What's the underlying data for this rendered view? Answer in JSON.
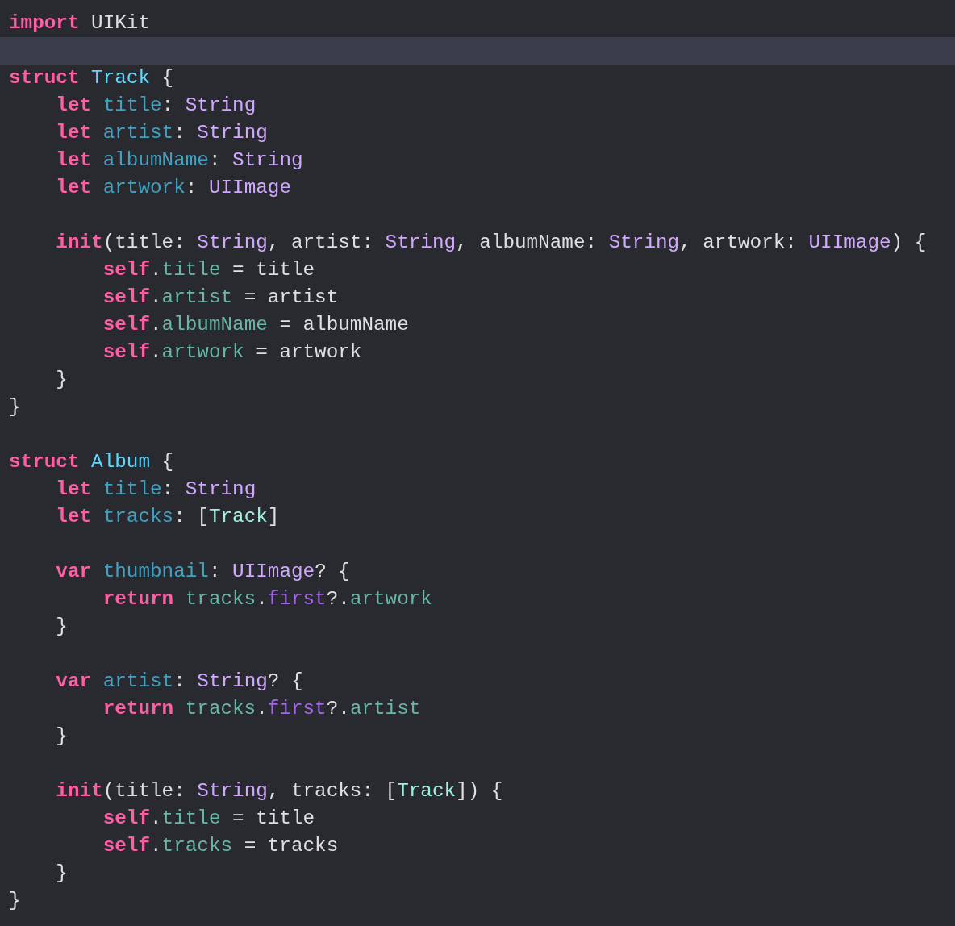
{
  "editor": {
    "lines": [
      {
        "current": false,
        "tokens": [
          {
            "kind": "keyword",
            "text": "import"
          },
          {
            "kind": "plain",
            "text": " UIKit"
          }
        ]
      },
      {
        "current": true
      },
      {
        "current": false,
        "tokens": [
          {
            "kind": "keyword",
            "text": "struct "
          },
          {
            "kind": "decl",
            "text": "Track"
          },
          {
            "kind": "plain",
            "text": " {"
          }
        ]
      },
      {
        "current": false,
        "tokens": [
          {
            "kind": "keyword",
            "text": "    let "
          },
          {
            "kind": "prop",
            "text": "title"
          },
          {
            "kind": "plain",
            "text": ": "
          },
          {
            "kind": "type",
            "text": "String"
          }
        ]
      },
      {
        "current": false,
        "tokens": [
          {
            "kind": "keyword",
            "text": "    let "
          },
          {
            "kind": "prop",
            "text": "artist"
          },
          {
            "kind": "plain",
            "text": ": "
          },
          {
            "kind": "type",
            "text": "String"
          }
        ]
      },
      {
        "current": false,
        "tokens": [
          {
            "kind": "keyword",
            "text": "    let "
          },
          {
            "kind": "prop",
            "text": "albumName"
          },
          {
            "kind": "plain",
            "text": ": "
          },
          {
            "kind": "type",
            "text": "String"
          }
        ]
      },
      {
        "current": false,
        "tokens": [
          {
            "kind": "keyword",
            "text": "    let "
          },
          {
            "kind": "prop",
            "text": "artwork"
          },
          {
            "kind": "plain",
            "text": ": "
          },
          {
            "kind": "type",
            "text": "UIImage"
          }
        ]
      },
      {
        "current": false
      },
      {
        "current": false,
        "tokens": [
          {
            "kind": "keyword",
            "text": "    init"
          },
          {
            "kind": "plain",
            "text": "(title: "
          },
          {
            "kind": "type",
            "text": "String"
          },
          {
            "kind": "plain",
            "text": ", artist: "
          },
          {
            "kind": "type",
            "text": "String"
          },
          {
            "kind": "plain",
            "text": ", albumName: "
          },
          {
            "kind": "type",
            "text": "String"
          },
          {
            "kind": "plain",
            "text": ", artwork: "
          },
          {
            "kind": "type",
            "text": "UIImage"
          },
          {
            "kind": "plain",
            "text": ") {"
          }
        ]
      },
      {
        "current": false,
        "tokens": [
          {
            "kind": "keyword",
            "text": "        self"
          },
          {
            "kind": "plain",
            "text": "."
          },
          {
            "kind": "member",
            "text": "title"
          },
          {
            "kind": "plain",
            "text": " = title"
          }
        ]
      },
      {
        "current": false,
        "tokens": [
          {
            "kind": "keyword",
            "text": "        self"
          },
          {
            "kind": "plain",
            "text": "."
          },
          {
            "kind": "member",
            "text": "artist"
          },
          {
            "kind": "plain",
            "text": " = artist"
          }
        ]
      },
      {
        "current": false,
        "tokens": [
          {
            "kind": "keyword",
            "text": "        self"
          },
          {
            "kind": "plain",
            "text": "."
          },
          {
            "kind": "member",
            "text": "albumName"
          },
          {
            "kind": "plain",
            "text": " = albumName"
          }
        ]
      },
      {
        "current": false,
        "tokens": [
          {
            "kind": "keyword",
            "text": "        self"
          },
          {
            "kind": "plain",
            "text": "."
          },
          {
            "kind": "member",
            "text": "artwork"
          },
          {
            "kind": "plain",
            "text": " = artwork"
          }
        ]
      },
      {
        "current": false,
        "tokens": [
          {
            "kind": "plain",
            "text": "    }"
          }
        ]
      },
      {
        "current": false,
        "tokens": [
          {
            "kind": "plain",
            "text": "}"
          }
        ]
      },
      {
        "current": false
      },
      {
        "current": false,
        "tokens": [
          {
            "kind": "keyword",
            "text": "struct "
          },
          {
            "kind": "decl",
            "text": "Album"
          },
          {
            "kind": "plain",
            "text": " {"
          }
        ]
      },
      {
        "current": false,
        "tokens": [
          {
            "kind": "keyword",
            "text": "    let "
          },
          {
            "kind": "prop",
            "text": "title"
          },
          {
            "kind": "plain",
            "text": ": "
          },
          {
            "kind": "type",
            "text": "String"
          }
        ]
      },
      {
        "current": false,
        "tokens": [
          {
            "kind": "keyword",
            "text": "    let "
          },
          {
            "kind": "prop",
            "text": "tracks"
          },
          {
            "kind": "plain",
            "text": ": ["
          },
          {
            "kind": "usertype",
            "text": "Track"
          },
          {
            "kind": "plain",
            "text": "]"
          }
        ]
      },
      {
        "current": false
      },
      {
        "current": false,
        "tokens": [
          {
            "kind": "keyword",
            "text": "    var "
          },
          {
            "kind": "prop",
            "text": "thumbnail"
          },
          {
            "kind": "plain",
            "text": ": "
          },
          {
            "kind": "type",
            "text": "UIImage"
          },
          {
            "kind": "plain",
            "text": "? {"
          }
        ]
      },
      {
        "current": false,
        "tokens": [
          {
            "kind": "keyword",
            "text": "        return "
          },
          {
            "kind": "member",
            "text": "tracks"
          },
          {
            "kind": "plain",
            "text": "."
          },
          {
            "kind": "method",
            "text": "first"
          },
          {
            "kind": "plain",
            "text": "?."
          },
          {
            "kind": "member",
            "text": "artwork"
          }
        ]
      },
      {
        "current": false,
        "tokens": [
          {
            "kind": "plain",
            "text": "    }"
          }
        ]
      },
      {
        "current": false
      },
      {
        "current": false,
        "tokens": [
          {
            "kind": "keyword",
            "text": "    var "
          },
          {
            "kind": "prop",
            "text": "artist"
          },
          {
            "kind": "plain",
            "text": ": "
          },
          {
            "kind": "type",
            "text": "String"
          },
          {
            "kind": "plain",
            "text": "? {"
          }
        ]
      },
      {
        "current": false,
        "tokens": [
          {
            "kind": "keyword",
            "text": "        return "
          },
          {
            "kind": "member",
            "text": "tracks"
          },
          {
            "kind": "plain",
            "text": "."
          },
          {
            "kind": "method",
            "text": "first"
          },
          {
            "kind": "plain",
            "text": "?."
          },
          {
            "kind": "member",
            "text": "artist"
          }
        ]
      },
      {
        "current": false,
        "tokens": [
          {
            "kind": "plain",
            "text": "    }"
          }
        ]
      },
      {
        "current": false
      },
      {
        "current": false,
        "tokens": [
          {
            "kind": "keyword",
            "text": "    init"
          },
          {
            "kind": "plain",
            "text": "(title: "
          },
          {
            "kind": "type",
            "text": "String"
          },
          {
            "kind": "plain",
            "text": ", tracks: ["
          },
          {
            "kind": "usertype",
            "text": "Track"
          },
          {
            "kind": "plain",
            "text": "]) {"
          }
        ]
      },
      {
        "current": false,
        "tokens": [
          {
            "kind": "keyword",
            "text": "        self"
          },
          {
            "kind": "plain",
            "text": "."
          },
          {
            "kind": "member",
            "text": "title"
          },
          {
            "kind": "plain",
            "text": " = title"
          }
        ]
      },
      {
        "current": false,
        "tokens": [
          {
            "kind": "keyword",
            "text": "        self"
          },
          {
            "kind": "plain",
            "text": "."
          },
          {
            "kind": "member",
            "text": "tracks"
          },
          {
            "kind": "plain",
            "text": " = tracks"
          }
        ]
      },
      {
        "current": false,
        "tokens": [
          {
            "kind": "plain",
            "text": "    }"
          }
        ]
      },
      {
        "current": false,
        "tokens": [
          {
            "kind": "plain",
            "text": "}"
          }
        ]
      }
    ]
  }
}
